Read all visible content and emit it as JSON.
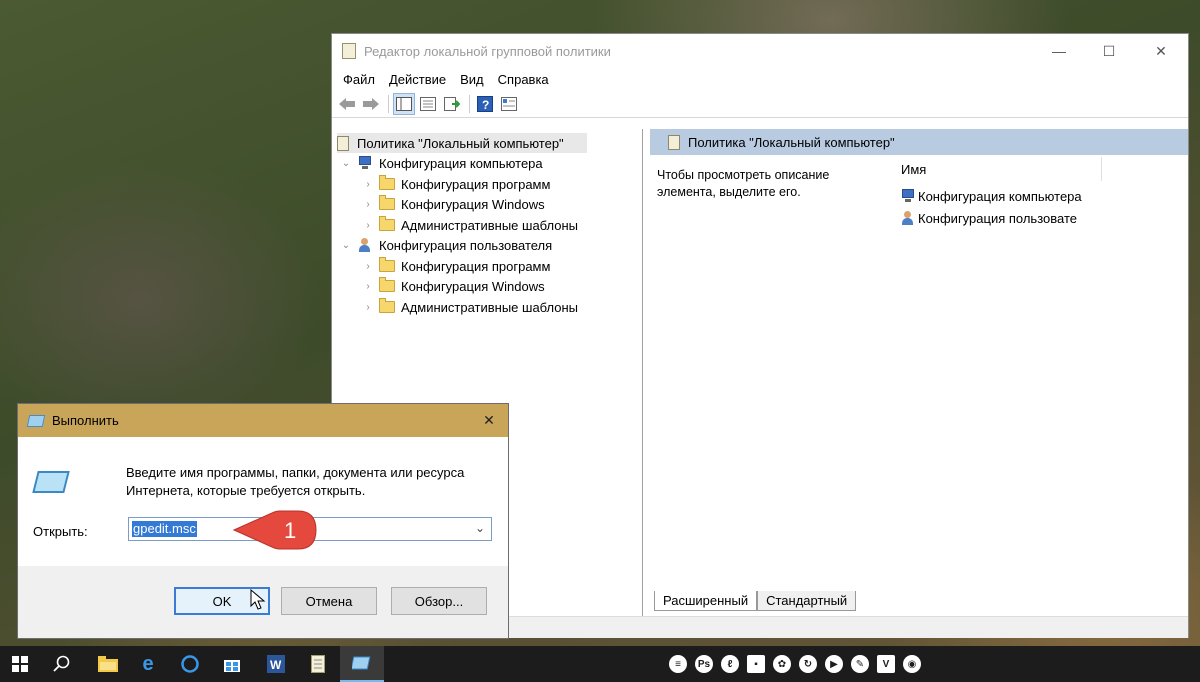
{
  "gp_window": {
    "title": "Редактор локальной групповой политики",
    "menu": [
      "Файл",
      "Действие",
      "Вид",
      "Справка"
    ],
    "window_controls": {
      "minimize": "—",
      "maximize": "☐",
      "close": "✕"
    },
    "tree": {
      "root": "Политика \"Локальный компьютер\"",
      "computer_config": "Конфигурация компьютера",
      "computer_children": [
        "Конфигурация программ",
        "Конфигурация Windows",
        "Административные шаблоны"
      ],
      "user_config": "Конфигурация пользователя",
      "user_children": [
        "Конфигурация программ",
        "Конфигурация Windows",
        "Административные шаблоны"
      ]
    },
    "right_pane": {
      "header": "Политика \"Локальный компьютер\"",
      "description": "Чтобы просмотреть описание элемента, выделите его.",
      "column_name": "Имя",
      "items": [
        "Конфигурация компьютера",
        "Конфигурация пользовате"
      ]
    },
    "tabs": [
      "Расширенный",
      "Стандартный"
    ]
  },
  "run_dialog": {
    "title": "Выполнить",
    "close": "✕",
    "message": "Введите имя программы, папки, документа или ресурса Интернета, которые требуется открыть.",
    "open_label": "Открыть:",
    "open_value": "gpedit.msc",
    "buttons": {
      "ok": "OK",
      "cancel": "Отмена",
      "browse": "Обзор..."
    }
  },
  "callout": {
    "number": "1",
    "color": "#e5483d"
  },
  "taskbar": {
    "apps": [
      "windows-start",
      "search",
      "file-explorer",
      "edge",
      "groove-music",
      "store",
      "word",
      "notepad",
      "run"
    ],
    "tray": [
      "Ps",
      "▶",
      "V"
    ]
  }
}
